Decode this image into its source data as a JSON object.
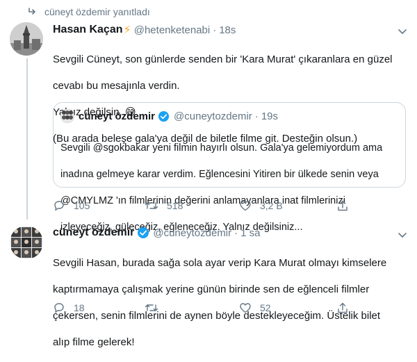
{
  "retweet_context": {
    "label": "cüneyt özdemir yanıtladı",
    "icon": "reply-retweet-icon"
  },
  "tweet1": {
    "author_name": "Hasan Kaçan",
    "author_emoji": "⚡",
    "handle": "@hetenketenabi",
    "dot": "·",
    "time": "18s",
    "lines": [
      "Sevgili Cüneyt, son günlerde senden bir 'Kara Murat' çıkaranlara en güzel",
      "cevabı bu mesajınla verdin.",
      "Yalnız değilsin. 😅",
      "(Bu arada beleşe gala'ya değil de biletle filme git. Desteğin olsun.)"
    ],
    "quote": {
      "author_name": "cüneyt özdemir",
      "handle": "@cuneytozdemir",
      "dot": "·",
      "time": "19s",
      "lines": [
        "Sevgili @sgokbakar yeni filmin hayırlı olsun. Gala'ya gelemiyordum ama",
        "inadına gelmeye karar verdim. Eğlencesini Yitiren bir ülkede senin veya",
        "@CMYLMZ 'ın filmlerinin değerini anlamayanlara inat filmlerinizi",
        "izleyeceğiz, güleceğiz, eğleneceğiz. Yalnız değilsiniz..."
      ]
    },
    "actions": {
      "replies": "105",
      "retweets": "518",
      "likes": "3,2 B"
    }
  },
  "tweet2": {
    "author_name": "cüneyt özdemir",
    "handle": "@cuneytozdemir",
    "dot": "·",
    "time": "1 sa",
    "lines": [
      "Sevgili Hasan, burada sağa sola ayar verip Kara Murat olmayı kimselere",
      "kaptırmamaya çalışmak yerine günün birinde sen de eğlenceli filmler",
      "çekersen, senin filmlerini de aynen böyle destekleyeceğim. Üstelik bilet",
      "alıp filme gelerek!"
    ],
    "actions": {
      "replies": "18",
      "retweets": "",
      "likes": "52"
    }
  },
  "colors": {
    "text": "#14171a",
    "muted": "#657786",
    "verified": "#1da1f2",
    "border": "#ccd6dd",
    "lightning": "#f5a623"
  }
}
